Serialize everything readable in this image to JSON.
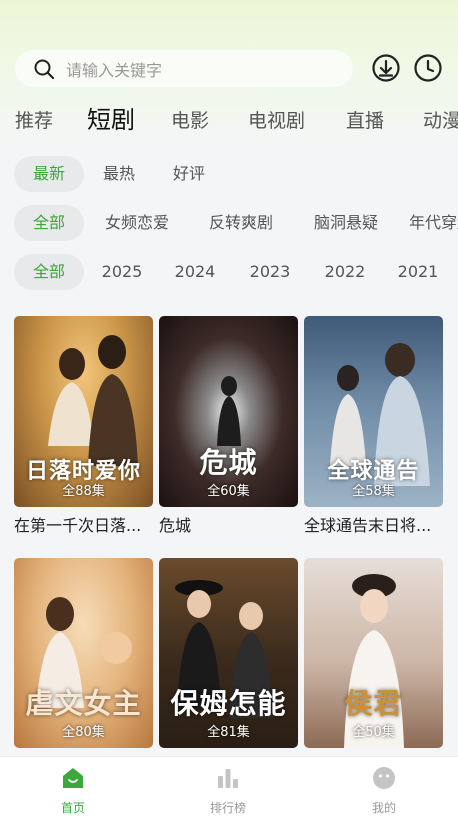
{
  "search": {
    "placeholder": "请输入关键字"
  },
  "icons": {
    "search": "search-icon",
    "download": "download-icon",
    "history": "clock-icon"
  },
  "tabs": [
    {
      "label": "推荐",
      "active": false
    },
    {
      "label": "短剧",
      "active": true
    },
    {
      "label": "电影",
      "active": false
    },
    {
      "label": "电视剧",
      "active": false
    },
    {
      "label": "直播",
      "active": false
    },
    {
      "label": "动漫",
      "active": false
    }
  ],
  "filters": {
    "sort": [
      "最新",
      "最热",
      "好评"
    ],
    "genre": [
      "全部",
      "女频恋爱",
      "反转爽剧",
      "脑洞悬疑",
      "年代穿越"
    ],
    "year": [
      "全部",
      "2025",
      "2024",
      "2023",
      "2022",
      "2021"
    ]
  },
  "cards": [
    {
      "title": "在第一千次日落...",
      "episodes": "全88集",
      "poster_text": "日落时爱你"
    },
    {
      "title": "危城",
      "episodes": "全60集",
      "poster_text": "危城"
    },
    {
      "title": "全球通告末日将...",
      "episodes": "全58集",
      "poster_text": "全球通告"
    },
    {
      "title": "",
      "episodes": "全80集",
      "poster_text": "虐文女主"
    },
    {
      "title": "",
      "episodes": "全81集",
      "poster_text": "保姆怎能"
    },
    {
      "title": "",
      "episodes": "全50集",
      "poster_text": "侯君"
    }
  ],
  "bottom_nav": [
    {
      "label": "首页",
      "active": true
    },
    {
      "label": "排行榜",
      "active": false
    },
    {
      "label": "我的",
      "active": false
    }
  ],
  "colors": {
    "accent": "#3aa83a",
    "background": "#f4f5f7"
  }
}
